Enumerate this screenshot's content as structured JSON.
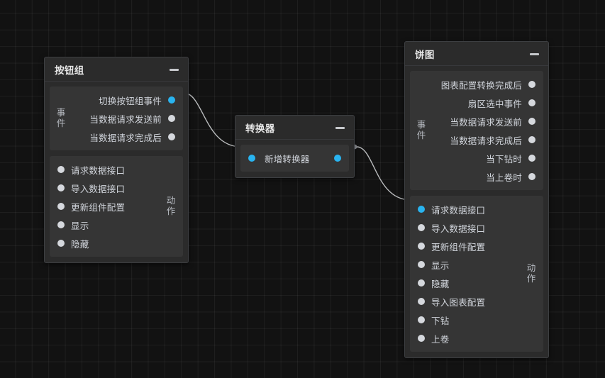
{
  "canvas": {
    "background_color": "#121212",
    "grid_color": "#232323",
    "grid_size": 23.4
  },
  "theme": {
    "node_background": "#2b2b2b",
    "node_border": "#3d3f42",
    "section_background": "#353535",
    "text_color": "#d2d6dd",
    "title_color": "#e8e8e8",
    "port_idle_color": "#d5d8dd",
    "port_active_color": "#29b4f0",
    "edge_color": "#b9bbbd"
  },
  "nodes": [
    {
      "id": "button-group",
      "title": "按钮组",
      "minimize_label": "—",
      "sections": [
        {
          "kind": "events",
          "side_label": "事件",
          "side_label_chars": [
            "事",
            "件"
          ],
          "rows": [
            {
              "label": "切换按钮组事件",
              "port_side": "right",
              "port_active": true
            },
            {
              "label": "当数据请求发送前",
              "port_side": "right",
              "port_active": false
            },
            {
              "label": "当数据请求完成后",
              "port_side": "right",
              "port_active": false
            }
          ]
        },
        {
          "kind": "actions",
          "side_label": "动作",
          "side_label_chars": [
            "动",
            "作"
          ],
          "rows": [
            {
              "label": "请求数据接口",
              "port_side": "left",
              "port_active": false
            },
            {
              "label": "导入数据接口",
              "port_side": "left",
              "port_active": false
            },
            {
              "label": "更新组件配置",
              "port_side": "left",
              "port_active": false
            },
            {
              "label": "显示",
              "port_side": "left",
              "port_active": false
            },
            {
              "label": "隐藏",
              "port_side": "left",
              "port_active": false
            }
          ]
        }
      ]
    },
    {
      "id": "converter",
      "title": "转换器",
      "minimize_label": "—",
      "sections": [
        {
          "kind": "dual",
          "side_label": "",
          "side_label_chars": [],
          "rows": [
            {
              "label": "新增转换器",
              "port_side": "both",
              "port_active": true
            }
          ]
        }
      ]
    },
    {
      "id": "pie",
      "title": "饼图",
      "minimize_label": "—",
      "sections": [
        {
          "kind": "events",
          "side_label": "事件",
          "side_label_chars": [
            "事",
            "件"
          ],
          "rows": [
            {
              "label": "图表配置转换完成后",
              "port_side": "right",
              "port_active": false
            },
            {
              "label": "扇区选中事件",
              "port_side": "right",
              "port_active": false
            },
            {
              "label": "当数据请求发送前",
              "port_side": "right",
              "port_active": false
            },
            {
              "label": "当数据请求完成后",
              "port_side": "right",
              "port_active": false
            },
            {
              "label": "当下钻时",
              "port_side": "right",
              "port_active": false
            },
            {
              "label": "当上卷时",
              "port_side": "right",
              "port_active": false
            }
          ]
        },
        {
          "kind": "actions",
          "side_label": "动作",
          "side_label_chars": [
            "动",
            "作"
          ],
          "rows": [
            {
              "label": "请求数据接口",
              "port_side": "left",
              "port_active": true
            },
            {
              "label": "导入数据接口",
              "port_side": "left",
              "port_active": false
            },
            {
              "label": "更新组件配置",
              "port_side": "left",
              "port_active": false
            },
            {
              "label": "显示",
              "port_side": "left",
              "port_active": false
            },
            {
              "label": "隐藏",
              "port_side": "left",
              "port_active": false
            },
            {
              "label": "导入图表配置",
              "port_side": "left",
              "port_active": false
            },
            {
              "label": "下钻",
              "port_side": "left",
              "port_active": false
            },
            {
              "label": "上卷",
              "port_side": "left",
              "port_active": false
            }
          ]
        }
      ]
    }
  ],
  "edges": [
    {
      "id": "edge-buttongroup-to-converter",
      "from_node": "button-group",
      "from_port": "切换按钮组事件",
      "to_node": "converter",
      "to_port": "新增转换器"
    },
    {
      "id": "edge-converter-to-pie",
      "from_node": "converter",
      "from_port": "新增转换器",
      "to_node": "pie",
      "to_port": "请求数据接口"
    }
  ]
}
